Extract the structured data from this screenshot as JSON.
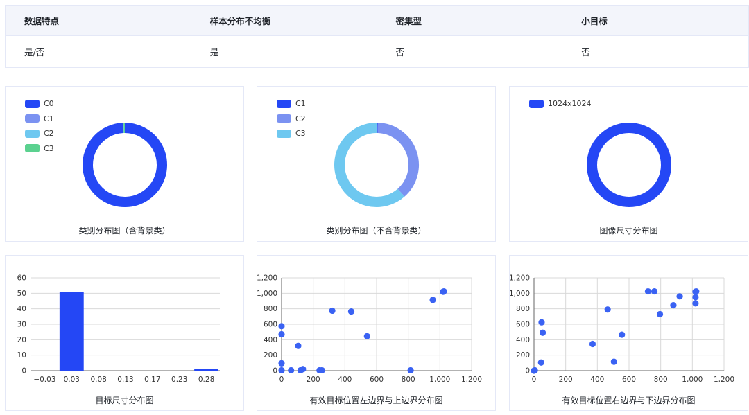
{
  "table": {
    "headers": [
      "数据特点",
      "样本分布不均衡",
      "密集型",
      "小目标"
    ],
    "values": [
      "是/否",
      "是",
      "否",
      "否"
    ]
  },
  "colors": {
    "blue": "#2447f5",
    "lightblue": "#7b92f1",
    "sky": "#6ec8f0",
    "green": "#5bd18f",
    "point": "#3a62f3",
    "grid": "#d9d9d9",
    "axis": "#666666"
  },
  "chart_data": [
    {
      "type": "pie",
      "title": "类别分布图（含背景类）",
      "labels": [
        "C0",
        "C1",
        "C2",
        "C3"
      ],
      "values": [
        99.2,
        0.1,
        0.2,
        0.5
      ],
      "colors": [
        "#2447f5",
        "#7b92f1",
        "#6ec8f0",
        "#5bd18f"
      ]
    },
    {
      "type": "pie",
      "title": "类别分布图（不含背景类）",
      "labels": [
        "C1",
        "C2",
        "C3"
      ],
      "values": [
        0.5,
        38,
        61.5
      ],
      "colors": [
        "#2447f5",
        "#7b92f1",
        "#6ec8f0"
      ]
    },
    {
      "type": "pie",
      "title": "图像尺寸分布图",
      "labels": [
        "1024x1024"
      ],
      "values": [
        100
      ],
      "colors": [
        "#2447f5"
      ]
    },
    {
      "type": "bar",
      "title": "目标尺寸分布图",
      "categories": [
        "-0.03",
        "0.03",
        "0.08",
        "0.13",
        "0.17",
        "0.23",
        "0.28"
      ],
      "values": [
        0,
        51,
        0,
        0,
        0,
        0,
        1
      ],
      "ylim": [
        0,
        60
      ],
      "yticks": [
        "0",
        "10",
        "20",
        "30",
        "40",
        "50",
        "60"
      ]
    },
    {
      "type": "scatter",
      "title": "有效目标位置左边界与上边界分布图",
      "xlim": [
        0,
        1200
      ],
      "ylim": [
        0,
        1200
      ],
      "xticks": [
        "0",
        "200",
        "400",
        "600",
        "800",
        "1,000",
        "1,200"
      ],
      "yticks": [
        "0",
        "200",
        "400",
        "600",
        "800",
        "1,000",
        "1,200"
      ],
      "points": [
        [
          0,
          575
        ],
        [
          0,
          470
        ],
        [
          0,
          95
        ],
        [
          0,
          5
        ],
        [
          60,
          5
        ],
        [
          105,
          320
        ],
        [
          120,
          5
        ],
        [
          135,
          20
        ],
        [
          240,
          5
        ],
        [
          255,
          5
        ],
        [
          320,
          775
        ],
        [
          440,
          765
        ],
        [
          540,
          445
        ],
        [
          815,
          5
        ],
        [
          955,
          915
        ],
        [
          1020,
          1020
        ],
        [
          1025,
          1025
        ]
      ]
    },
    {
      "type": "scatter",
      "title": "有效目标位置右边界与下边界分布图",
      "xlim": [
        0,
        1200
      ],
      "ylim": [
        0,
        1200
      ],
      "xticks": [
        "0",
        "200",
        "400",
        "600",
        "800",
        "1,000",
        "1,200"
      ],
      "yticks": [
        "0",
        "200",
        "400",
        "600",
        "800",
        "1,000",
        "1,200"
      ],
      "points": [
        [
          0,
          0
        ],
        [
          5,
          5
        ],
        [
          45,
          105
        ],
        [
          48,
          625
        ],
        [
          55,
          490
        ],
        [
          370,
          345
        ],
        [
          465,
          790
        ],
        [
          505,
          115
        ],
        [
          555,
          465
        ],
        [
          720,
          1025
        ],
        [
          760,
          1025
        ],
        [
          795,
          730
        ],
        [
          880,
          845
        ],
        [
          920,
          960
        ],
        [
          1020,
          1020
        ],
        [
          1020,
          950
        ],
        [
          1020,
          870
        ],
        [
          1024,
          1024
        ]
      ]
    }
  ]
}
